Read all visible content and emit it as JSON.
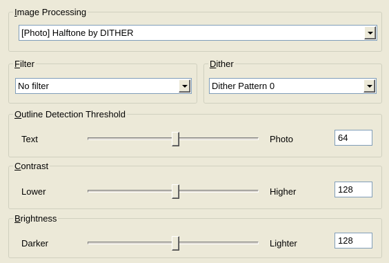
{
  "image_processing": {
    "legend_key": "I",
    "legend_rest": "mage Processing",
    "selected": "[Photo] Halftone by DITHER"
  },
  "filter": {
    "legend_key": "F",
    "legend_rest": "ilter",
    "selected": "No filter"
  },
  "dither": {
    "legend_key": "D",
    "legend_rest": "ither",
    "selected": "Dither Pattern 0"
  },
  "outline": {
    "legend_key": "O",
    "legend_rest": "utline Detection Threshold",
    "left_label": "Text",
    "right_label": "Photo",
    "value": "64"
  },
  "contrast": {
    "legend_key": "C",
    "legend_rest": "ontrast",
    "left_label": "Lower",
    "right_label": "Higher",
    "value": "128"
  },
  "brightness": {
    "legend_key": "B",
    "legend_rest": "rightness",
    "left_label": "Darker",
    "right_label": "Lighter",
    "value": "128"
  }
}
